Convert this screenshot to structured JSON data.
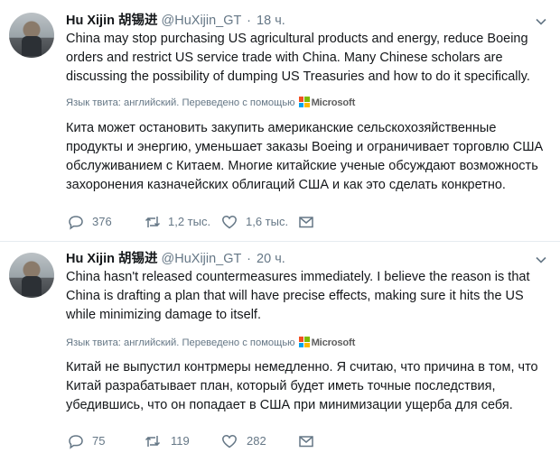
{
  "tweets": [
    {
      "author_name": "Hu Xijin 胡锡进",
      "handle": "@HuXijin_GT",
      "separator": "·",
      "time": "18 ч.",
      "text_en": "China may stop purchasing US agricultural products and energy, reduce Boeing orders and restrict US service trade with China. Many Chinese scholars are discussing the possibility of dumping US Treasuries and how to do it specifically.",
      "translation_note": "Язык твита: английский. Переведено с помощью",
      "translator": "Microsoft",
      "text_ru": "Кита может остановить закупить американские сельскохозяйственные продукты и энергию, уменьшает заказы Boeing и ограничивает торговлю США обслуживанием с Китаем. Многие китайские ученые обсуждают возможность захоронения казначейских облигаций США и как это сделать конкретно.",
      "replies": "376",
      "retweets": "1,2 тыс.",
      "likes": "1,6 тыс."
    },
    {
      "author_name": "Hu Xijin 胡锡进",
      "handle": "@HuXijin_GT",
      "separator": "·",
      "time": "20 ч.",
      "text_en": "China hasn't released countermeasures immediately. I believe the reason is that China is drafting a plan that will have precise effects, making sure it hits the US while minimizing damage to itself.",
      "translation_note": "Язык твита: английский. Переведено с помощью",
      "translator": "Microsoft",
      "text_ru": "Китай не выпустил контрмеры немедленно. Я считаю, что причина в том, что Китай разрабатывает план, который будет иметь точные последствия, убедившись, что он попадает в США при минимизации ущерба для себя.",
      "replies": "75",
      "retweets": "119",
      "likes": "282"
    }
  ],
  "icons": {
    "reply": "reply-icon",
    "retweet": "retweet-icon",
    "like": "heart-icon",
    "dm": "envelope-icon",
    "menu": "chevron-down-icon",
    "translator_logo": "microsoft-logo-icon"
  },
  "colors": {
    "text": "#14171a",
    "secondary": "#657786",
    "divider": "#e6ecf0"
  }
}
